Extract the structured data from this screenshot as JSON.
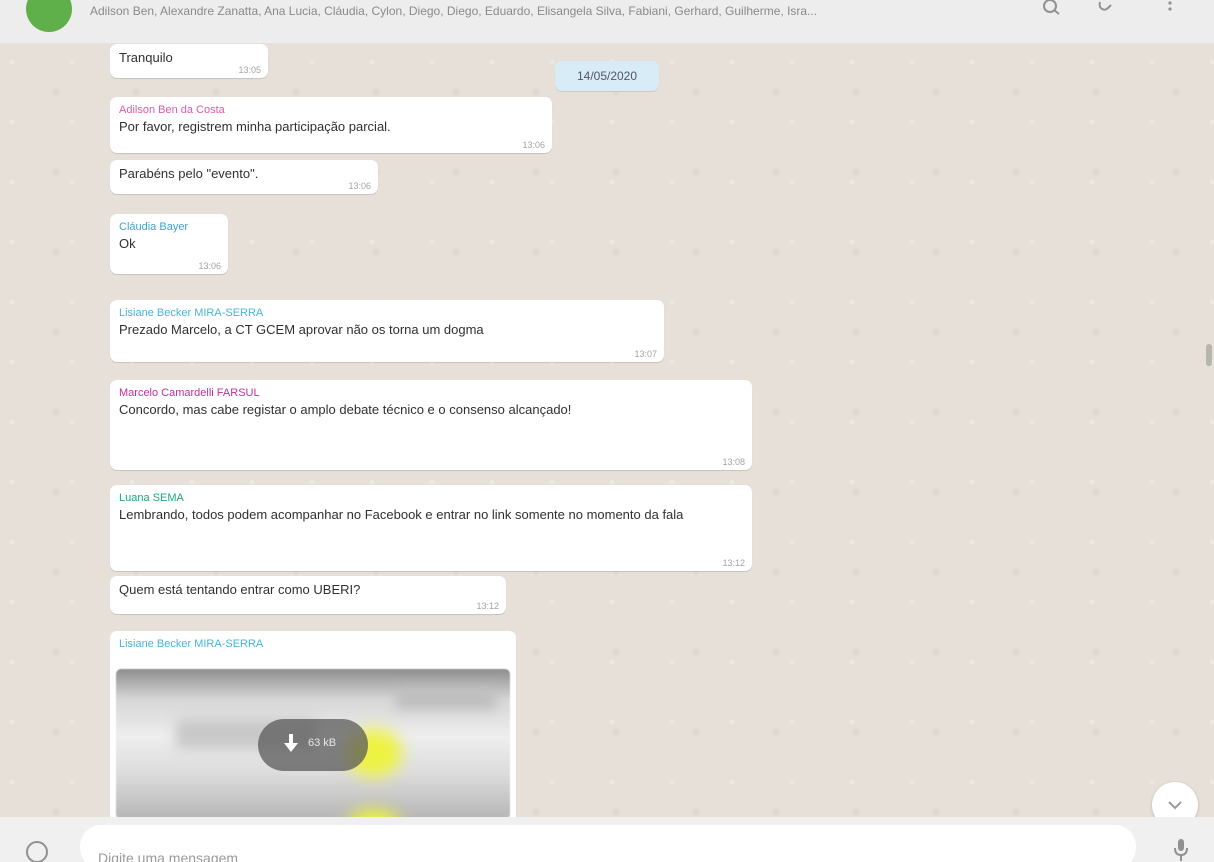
{
  "header": {
    "members": "Adilson Ben, Alexandre Zanatta, Ana Lucia, Cláudia, Cylon, Diego, Diego, Eduardo, Elisangela Silva, Fabiani, Gerhard, Guilherme, Isra..."
  },
  "date_chip": "14/05/2020",
  "messages": [
    {
      "sender": "",
      "text": "Tranquilo",
      "time": "13:05"
    },
    {
      "sender": "Adilson Ben da Costa",
      "sender_color": "#e05aa9",
      "text": "Por favor, registrem minha participação parcial.",
      "time": "13:06"
    },
    {
      "sender": "",
      "text": "Parabéns pelo \"evento\".",
      "time": "13:06"
    },
    {
      "sender": "Cláudia Bayer",
      "sender_color": "#3fa2d6",
      "text": "Ok",
      "time": "13:06"
    },
    {
      "sender": "Lisiane Becker MIRA-SERRA",
      "sender_color": "#47b5d9",
      "text": "Prezado Marcelo, a CT GCEM aprovar não os torna um dogma",
      "time": "13:07"
    },
    {
      "sender": "Marcelo Camardelli FARSUL",
      "sender_color": "#c42f9e",
      "text": "Concordo, mas cabe registar o amplo debate técnico e o consenso alcançado!",
      "time": "13:08"
    },
    {
      "sender": "Luana SEMA",
      "sender_color": "#1ea77d",
      "text": "Lembrando, todos podem acompanhar no Facebook e entrar no link somente no momento da fala",
      "time": "13:12"
    },
    {
      "sender": "",
      "text": "Quem está tentando entrar como UBERI?",
      "time": "13:12"
    },
    {
      "sender": "Lisiane Becker MIRA-SERRA",
      "sender_color": "#47b5d9",
      "text": "",
      "time": ""
    }
  ],
  "download": {
    "size": "63 kB"
  },
  "footer": {
    "placeholder": "Digite uma mensagem"
  },
  "icons": [
    "search-icon",
    "attach-icon",
    "menu-icon",
    "scroll-down-icon",
    "emoji-icon",
    "mic-icon",
    "download-icon"
  ]
}
